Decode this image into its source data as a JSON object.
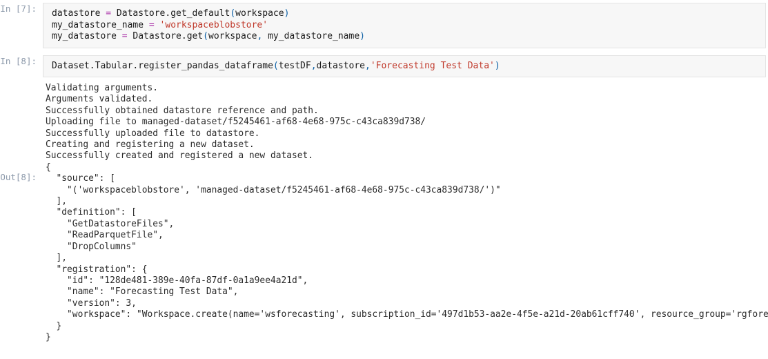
{
  "cells": [
    {
      "prompt": "In [7]:",
      "type": "code",
      "lines": [
        {
          "tokens": [
            {
              "t": "datastore ",
              "c": "name"
            },
            {
              "t": "=",
              "c": "op"
            },
            {
              "t": " Datastore",
              "c": "name"
            },
            {
              "t": ".",
              "c": "name"
            },
            {
              "t": "get_default",
              "c": "name"
            },
            {
              "t": "(",
              "c": "punct"
            },
            {
              "t": "workspace",
              "c": "name"
            },
            {
              "t": ")",
              "c": "punct"
            }
          ]
        },
        {
          "tokens": [
            {
              "t": "my_datastore_name ",
              "c": "name"
            },
            {
              "t": "=",
              "c": "op"
            },
            {
              "t": " ",
              "c": "name"
            },
            {
              "t": "'workspaceblobstore'",
              "c": "str"
            }
          ]
        },
        {
          "tokens": [
            {
              "t": "my_datastore ",
              "c": "name"
            },
            {
              "t": "=",
              "c": "op"
            },
            {
              "t": " Datastore",
              "c": "name"
            },
            {
              "t": ".",
              "c": "name"
            },
            {
              "t": "get",
              "c": "name"
            },
            {
              "t": "(",
              "c": "punct"
            },
            {
              "t": "workspace",
              "c": "name"
            },
            {
              "t": ",",
              "c": "punct"
            },
            {
              "t": " my_datastore_name",
              "c": "name"
            },
            {
              "t": ")",
              "c": "punct"
            }
          ]
        }
      ]
    },
    {
      "prompt": "In [8]:",
      "type": "code",
      "lines": [
        {
          "tokens": [
            {
              "t": "Dataset",
              "c": "name"
            },
            {
              "t": ".",
              "c": "name"
            },
            {
              "t": "Tabular",
              "c": "name"
            },
            {
              "t": ".",
              "c": "name"
            },
            {
              "t": "register_pandas_dataframe",
              "c": "name"
            },
            {
              "t": "(",
              "c": "punct"
            },
            {
              "t": "testDF",
              "c": "name"
            },
            {
              "t": ",",
              "c": "punct"
            },
            {
              "t": "datastore",
              "c": "name"
            },
            {
              "t": ",",
              "c": "punct"
            },
            {
              "t": "'Forecasting Test Data'",
              "c": "str"
            },
            {
              "t": ")",
              "c": "punct"
            }
          ]
        }
      ]
    }
  ],
  "stream_output": {
    "lines": [
      "Validating arguments.",
      "Arguments validated.",
      "Successfully obtained datastore reference and path.",
      "Uploading file to managed-dataset/f5245461-af68-4e68-975c-c43ca839d738/",
      "Successfully uploaded file to datastore.",
      "Creating and registering a new dataset.",
      "Successfully created and registered a new dataset."
    ]
  },
  "result_output": {
    "prompt": "Out[8]:",
    "lines": [
      "{",
      "  \"source\": [",
      "    \"('workspaceblobstore', 'managed-dataset/f5245461-af68-4e68-975c-c43ca839d738/')\"",
      "  ],",
      "  \"definition\": [",
      "    \"GetDatastoreFiles\",",
      "    \"ReadParquetFile\",",
      "    \"DropColumns\"",
      "  ],",
      "  \"registration\": {",
      "    \"id\": \"128de481-389e-40fa-87df-0a1a9ee4a21d\",",
      "    \"name\": \"Forecasting Test Data\",",
      "    \"version\": 3,",
      "    \"workspace\": \"Workspace.create(name='wsforecasting', subscription_id='497d1b53-aa2e-4f5e-a21d-20ab61cff740', resource_group='rgforecasting')\"",
      "  }",
      "}"
    ]
  },
  "colors": {
    "cell_background": "#f7f7f7",
    "cell_border": "#e4e4e4",
    "prompt_text": "#8d9aab",
    "code_text": "#1a1a1a",
    "string_token": "#c0392b",
    "operator_token": "#a626a4",
    "punct_token": "#0b5fa5",
    "output_text": "#2b2b2b",
    "page_background": "#ffffff"
  }
}
